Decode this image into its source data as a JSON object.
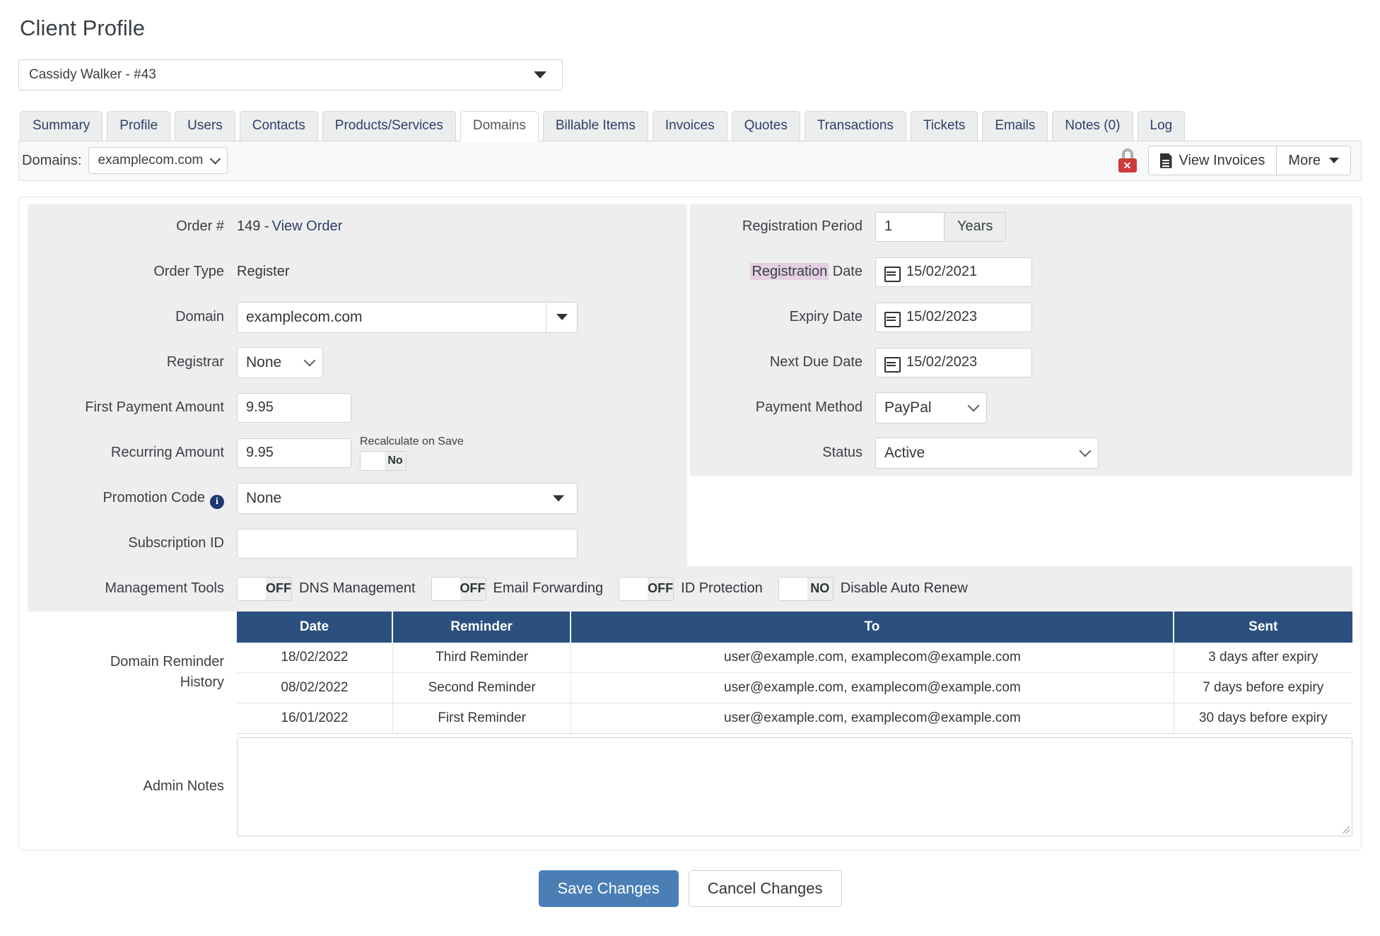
{
  "page": {
    "title": "Client Profile"
  },
  "client_select": {
    "value": "Cassidy Walker - #43",
    "icon": "chevron-down-icon"
  },
  "tabs": [
    {
      "label": "Summary",
      "active": false
    },
    {
      "label": "Profile",
      "active": false
    },
    {
      "label": "Users",
      "active": false
    },
    {
      "label": "Contacts",
      "active": false
    },
    {
      "label": "Products/Services",
      "active": false
    },
    {
      "label": "Domains",
      "active": true
    },
    {
      "label": "Billable Items",
      "active": false
    },
    {
      "label": "Invoices",
      "active": false
    },
    {
      "label": "Quotes",
      "active": false
    },
    {
      "label": "Transactions",
      "active": false
    },
    {
      "label": "Tickets",
      "active": false
    },
    {
      "label": "Emails",
      "active": false
    },
    {
      "label": "Notes (0)",
      "active": false
    },
    {
      "label": "Log",
      "active": false
    }
  ],
  "toolbar": {
    "domains_label": "Domains:",
    "domain_value": "examplecom.com",
    "lock_icon": "lock-unsecured-icon",
    "view_invoices_label": "View Invoices",
    "view_invoices_icon": "invoice-document-icon",
    "more_label": "More",
    "more_icon": "caret-down-icon"
  },
  "form": {
    "left": {
      "order_number_label": "Order #",
      "order_number_value": "149 - ",
      "order_number_link": "View Order",
      "order_type_label": "Order Type",
      "order_type_value": "Register",
      "domain_label": "Domain",
      "domain_value": "examplecom.com",
      "registrar_label": "Registrar",
      "registrar_value": "None",
      "first_payment_label": "First Payment Amount",
      "first_payment_value": "9.95",
      "recurring_label": "Recurring Amount",
      "recurring_value": "9.95",
      "recalculate_caption": "Recalculate on Save",
      "recalculate_value": "No",
      "promotion_label": "Promotion Code",
      "promotion_info_icon": "info-icon",
      "promotion_value": "None",
      "subscription_label": "Subscription ID",
      "subscription_value": "",
      "management_label": "Management Tools",
      "management_tools": [
        {
          "state": "OFF",
          "caption": "DNS Management"
        },
        {
          "state": "OFF",
          "caption": "Email Forwarding"
        },
        {
          "state": "OFF",
          "caption": "ID Protection"
        },
        {
          "state": "NO",
          "caption": "Disable Auto Renew"
        }
      ]
    },
    "right": {
      "registration_period_label": "Registration Period",
      "registration_period_value": "1",
      "registration_period_unit": "Years",
      "registration_date_label_hl": "Registration",
      "registration_date_label_rest": " Date",
      "registration_date_value": "15/02/2021",
      "expiry_date_label": "Expiry Date",
      "expiry_date_value": "15/02/2023",
      "next_due_label": "Next Due Date",
      "next_due_value": "15/02/2023",
      "payment_method_label": "Payment Method",
      "payment_method_value": "PayPal",
      "status_label": "Status",
      "status_value": "Active"
    }
  },
  "reminder_history": {
    "label_line1": "Domain Reminder",
    "label_line2": "History",
    "columns": [
      "Date",
      "Reminder",
      "To",
      "Sent"
    ],
    "rows": [
      [
        "18/02/2022",
        "Third Reminder",
        "user@example.com, examplecom@example.com",
        "3 days after expiry"
      ],
      [
        "08/02/2022",
        "Second Reminder",
        "user@example.com, examplecom@example.com",
        "7 days before expiry"
      ],
      [
        "16/01/2022",
        "First Reminder",
        "user@example.com, examplecom@example.com",
        "30 days before expiry"
      ]
    ]
  },
  "admin_notes": {
    "label": "Admin Notes",
    "value": "",
    "placeholder": ""
  },
  "footer": {
    "save_label": "Save Changes",
    "cancel_label": "Cancel Changes"
  },
  "colors": {
    "accent_primary": "#4a7eb5",
    "table_header": "#2b4f7e",
    "tab_text": "#2d4068",
    "highlight": "#e4cfe4",
    "danger": "#cf3a3a",
    "stripe": "#eeeeef"
  }
}
